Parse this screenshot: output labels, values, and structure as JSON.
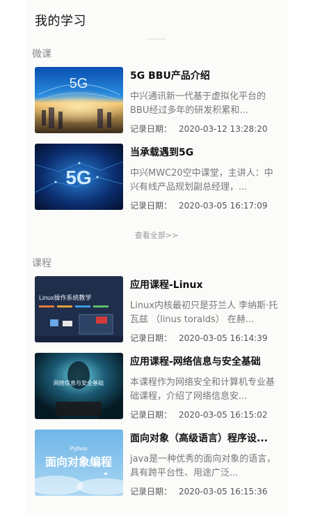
{
  "header": {
    "title": "我的学习"
  },
  "sections": [
    {
      "title": "微课",
      "items": [
        {
          "title": "5G BBU产品介绍",
          "desc": "中兴通讯新一代基于虚拟化平台的BBU经过多年的研发积累和...",
          "date_label": "记录日期：",
          "date": "2020-03-12 13:28:20",
          "thumb_text": "5G"
        },
        {
          "title": "当承载遇到5G",
          "desc": "中兴MWC20空中课堂，主讲人：中兴有线产品规划副总经理，...",
          "date_label": "记录日期：",
          "date": "2020-03-05 16:17:09",
          "thumb_text": "5G"
        }
      ],
      "view_all": "查看全部>>"
    },
    {
      "title": "课程",
      "items": [
        {
          "title": "应用课程-Linux",
          "desc": "Linux内核最初只是芬兰人 李纳斯·托瓦兹 （linus toralds） 在赫...",
          "date_label": "记录日期：",
          "date": "2020-03-05 16:14:39",
          "thumb_text": "Linux操作系统教学"
        },
        {
          "title": "应用课程-网络信息与安全基础",
          "desc": "本课程作为网络安全和计算机专业基础课程，介绍了网络信息安...",
          "date_label": "记录日期：",
          "date": "2020-03-05 16:15:02",
          "thumb_text": "网络信息与安全基础"
        },
        {
          "title": "面向对象（高级语言）程序设...",
          "desc": "java是一种优秀的面向对象的语言，具有跨平台性、用途广泛...",
          "date_label": "记录日期：",
          "date": "2020-03-05 16:15:36",
          "thumb_text": "面向对象编程",
          "thumb_subtext": "Python"
        }
      ]
    }
  ],
  "colors": {
    "section_title": "#8a8a8a",
    "card_title": "#111111",
    "desc": "#777777"
  }
}
